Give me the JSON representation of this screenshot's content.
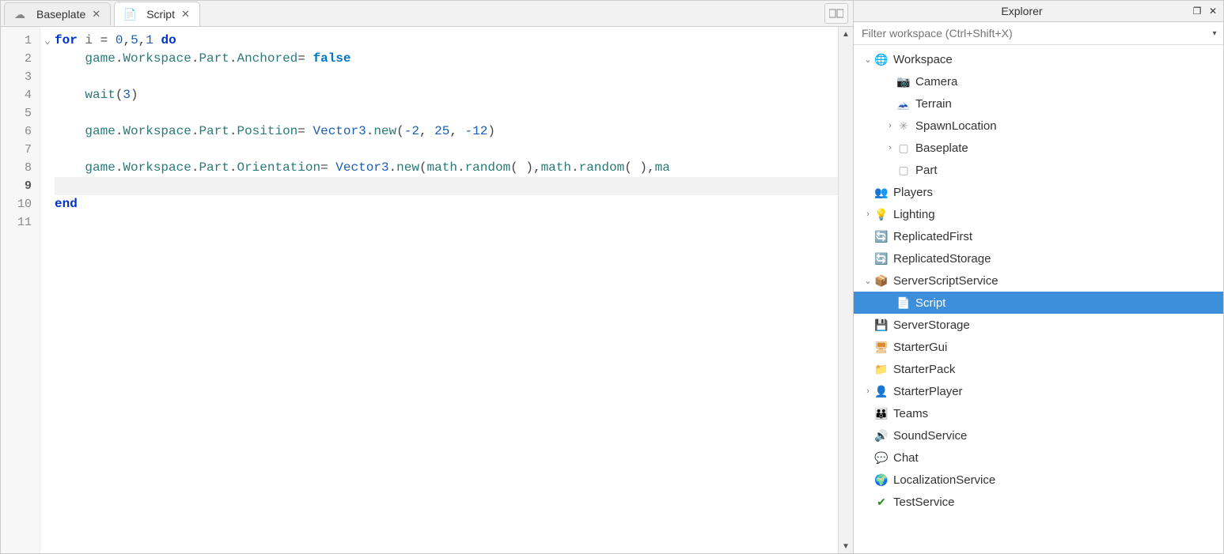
{
  "tabs": [
    {
      "label": "Baseplate",
      "icon": "cloud",
      "active": false
    },
    {
      "label": "Script",
      "icon": "script",
      "active": true
    }
  ],
  "explorer": {
    "title": "Explorer",
    "filter_placeholder": "Filter workspace (Ctrl+Shift+X)"
  },
  "tree": [
    {
      "indent": 0,
      "twisty": "v",
      "icon": "globe",
      "label": "Workspace"
    },
    {
      "indent": 1,
      "twisty": "",
      "icon": "camera",
      "label": "Camera"
    },
    {
      "indent": 1,
      "twisty": "",
      "icon": "terrain",
      "label": "Terrain"
    },
    {
      "indent": 1,
      "twisty": ">",
      "icon": "spawn",
      "label": "SpawnLocation"
    },
    {
      "indent": 1,
      "twisty": ">",
      "icon": "part",
      "label": "Baseplate"
    },
    {
      "indent": 1,
      "twisty": "",
      "icon": "part",
      "label": "Part"
    },
    {
      "indent": 0,
      "twisty": "",
      "icon": "players",
      "label": "Players"
    },
    {
      "indent": 0,
      "twisty": ">",
      "icon": "light",
      "label": "Lighting"
    },
    {
      "indent": 0,
      "twisty": "",
      "icon": "repl",
      "label": "ReplicatedFirst"
    },
    {
      "indent": 0,
      "twisty": "",
      "icon": "repl",
      "label": "ReplicatedStorage"
    },
    {
      "indent": 0,
      "twisty": "v",
      "icon": "sscript",
      "label": "ServerScriptService"
    },
    {
      "indent": 1,
      "twisty": "",
      "icon": "script",
      "label": "Script",
      "selected": true
    },
    {
      "indent": 0,
      "twisty": "",
      "icon": "storage",
      "label": "ServerStorage"
    },
    {
      "indent": 0,
      "twisty": "",
      "icon": "gui",
      "label": "StarterGui"
    },
    {
      "indent": 0,
      "twisty": "",
      "icon": "pack",
      "label": "StarterPack"
    },
    {
      "indent": 0,
      "twisty": ">",
      "icon": "player",
      "label": "StarterPlayer"
    },
    {
      "indent": 0,
      "twisty": "",
      "icon": "teams",
      "label": "Teams"
    },
    {
      "indent": 0,
      "twisty": "",
      "icon": "sound",
      "label": "SoundService"
    },
    {
      "indent": 0,
      "twisty": "",
      "icon": "chat",
      "label": "Chat"
    },
    {
      "indent": 0,
      "twisty": "",
      "icon": "loc",
      "label": "LocalizationService"
    },
    {
      "indent": 0,
      "twisty": "",
      "icon": "test",
      "label": "TestService"
    }
  ],
  "code": {
    "current_line": 9,
    "lines": [
      [
        {
          "t": "kw",
          "v": "for"
        },
        {
          "t": "plain",
          "v": " i "
        },
        {
          "t": "op",
          "v": "="
        },
        {
          "t": "plain",
          "v": " "
        },
        {
          "t": "num",
          "v": "0"
        },
        {
          "t": "op",
          "v": ","
        },
        {
          "t": "num",
          "v": "5"
        },
        {
          "t": "op",
          "v": ","
        },
        {
          "t": "num",
          "v": "1"
        },
        {
          "t": "plain",
          "v": " "
        },
        {
          "t": "kw",
          "v": "do"
        }
      ],
      [
        {
          "t": "plain",
          "v": "    "
        },
        {
          "t": "id",
          "v": "game"
        },
        {
          "t": "op",
          "v": "."
        },
        {
          "t": "id",
          "v": "Workspace"
        },
        {
          "t": "op",
          "v": "."
        },
        {
          "t": "id",
          "v": "Part"
        },
        {
          "t": "op",
          "v": "."
        },
        {
          "t": "id",
          "v": "Anchored"
        },
        {
          "t": "op",
          "v": "= "
        },
        {
          "t": "bool",
          "v": "false"
        }
      ],
      [],
      [
        {
          "t": "plain",
          "v": "    "
        },
        {
          "t": "id",
          "v": "wait"
        },
        {
          "t": "op",
          "v": "("
        },
        {
          "t": "num",
          "v": "3"
        },
        {
          "t": "op",
          "v": ")"
        }
      ],
      [],
      [
        {
          "t": "plain",
          "v": "    "
        },
        {
          "t": "id",
          "v": "game"
        },
        {
          "t": "op",
          "v": "."
        },
        {
          "t": "id",
          "v": "Workspace"
        },
        {
          "t": "op",
          "v": "."
        },
        {
          "t": "id",
          "v": "Part"
        },
        {
          "t": "op",
          "v": "."
        },
        {
          "t": "id",
          "v": "Position"
        },
        {
          "t": "op",
          "v": "= "
        },
        {
          "t": "fn",
          "v": "Vector3"
        },
        {
          "t": "op",
          "v": "."
        },
        {
          "t": "id",
          "v": "new"
        },
        {
          "t": "op",
          "v": "("
        },
        {
          "t": "num",
          "v": "-2"
        },
        {
          "t": "op",
          "v": ", "
        },
        {
          "t": "num",
          "v": "25"
        },
        {
          "t": "op",
          "v": ", "
        },
        {
          "t": "num",
          "v": "-12"
        },
        {
          "t": "op",
          "v": ")"
        }
      ],
      [],
      [
        {
          "t": "plain",
          "v": "    "
        },
        {
          "t": "id",
          "v": "game"
        },
        {
          "t": "op",
          "v": "."
        },
        {
          "t": "id",
          "v": "Workspace"
        },
        {
          "t": "op",
          "v": "."
        },
        {
          "t": "id",
          "v": "Part"
        },
        {
          "t": "op",
          "v": "."
        },
        {
          "t": "id",
          "v": "Orientation"
        },
        {
          "t": "op",
          "v": "= "
        },
        {
          "t": "fn",
          "v": "Vector3"
        },
        {
          "t": "op",
          "v": "."
        },
        {
          "t": "id",
          "v": "new"
        },
        {
          "t": "op",
          "v": "("
        },
        {
          "t": "id",
          "v": "math"
        },
        {
          "t": "op",
          "v": "."
        },
        {
          "t": "id",
          "v": "random"
        },
        {
          "t": "op",
          "v": "( ),"
        },
        {
          "t": "id",
          "v": "math"
        },
        {
          "t": "op",
          "v": "."
        },
        {
          "t": "id",
          "v": "random"
        },
        {
          "t": "op",
          "v": "( ),"
        },
        {
          "t": "id",
          "v": "ma"
        }
      ],
      [],
      [
        {
          "t": "kw",
          "v": "end"
        }
      ],
      []
    ]
  },
  "icons": {
    "cloud": "☁",
    "script": "📄",
    "globe": "🌐",
    "camera": "📷",
    "terrain": "🗻",
    "spawn": "✳",
    "part": "▢",
    "players": "👥",
    "light": "💡",
    "repl": "🔄",
    "sscript": "📦",
    "storage": "💾",
    "gui": "🖥",
    "pack": "📁",
    "player": "👤",
    "teams": "👪",
    "sound": "🔊",
    "chat": "💬",
    "loc": "🌍",
    "test": "✔"
  }
}
